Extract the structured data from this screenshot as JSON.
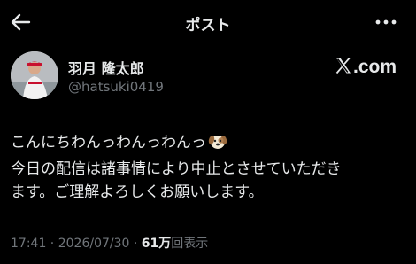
{
  "header": {
    "title": "ポスト"
  },
  "author": {
    "display_name": "羽月 隆太郎",
    "handle": "@hatsuki0419"
  },
  "source": {
    "label": ".com"
  },
  "post": {
    "lines": [
      "こんにちわんっわんっわんっ",
      "今日の配信は諸事情により中止とさせていただき",
      "ます。ご理解よろしくお願いします。"
    ],
    "emoji": "dog-face"
  },
  "meta": {
    "time": "17:41",
    "separator1": " · ",
    "date": "2026/07/30",
    "separator2": " · ",
    "views_count": "61万",
    "views_label": "回表示"
  },
  "colors": {
    "background": "#000000",
    "text_primary": "#e7e9ea",
    "text_secondary": "#71767b"
  }
}
